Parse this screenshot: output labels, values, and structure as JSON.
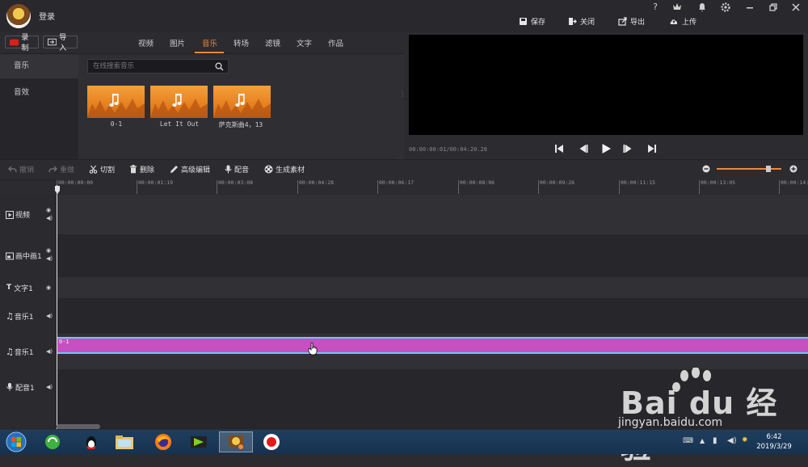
{
  "header": {
    "login_label": "登录",
    "window_controls": [
      "?",
      "VIP",
      "bell",
      "gear",
      "minimize",
      "restore",
      "close"
    ],
    "actions": {
      "save": "保存",
      "close": "关闭",
      "export": "导出",
      "upload": "上传"
    }
  },
  "library": {
    "record_label": "录制",
    "import_label": "导入",
    "tabs": [
      "视频",
      "图片",
      "音乐",
      "转场",
      "滤镜",
      "文字",
      "作品"
    ],
    "active_tab": "音乐",
    "categories": [
      "音乐",
      "音效"
    ],
    "search_placeholder": "在线搜索音乐",
    "items": [
      {
        "caption": "0-1"
      },
      {
        "caption": "Let It Out"
      },
      {
        "caption": "萨克斯曲4，13"
      }
    ]
  },
  "preview": {
    "timecode": "00:00:00:01/00:04:20.28"
  },
  "toolbar": {
    "undo": "撤销",
    "redo": "重做",
    "cut": "切割",
    "delete": "删除",
    "advanced_edit": "高级编辑",
    "dub": "配音",
    "generate": "生成素材"
  },
  "ruler": {
    "ticks": [
      "00:00:00:00",
      "00:00:01:19",
      "00:00:03:08",
      "00:00:04:28",
      "00:00:06:17",
      "00:00:08:06",
      "00:00:09:26",
      "00:00:11:15",
      "00:00:13:05",
      "00:00:14:"
    ]
  },
  "tracks": [
    {
      "name": "视频"
    },
    {
      "name": "画中画1"
    },
    {
      "name": "文字1"
    },
    {
      "name": "音乐1"
    },
    {
      "name": "音乐1"
    },
    {
      "name": "配音1"
    }
  ],
  "clip": {
    "label": "0-1"
  },
  "taskbar": {
    "time": "6:42",
    "date": "2019/3/29"
  },
  "watermark": {
    "brand": "Bai du 经验",
    "url": "jingyan.baidu.com"
  },
  "colors": {
    "accent": "#f0883a",
    "clip": "#c84fc2",
    "clip_border": "#5fd0f0",
    "record": "#e21b1b"
  }
}
